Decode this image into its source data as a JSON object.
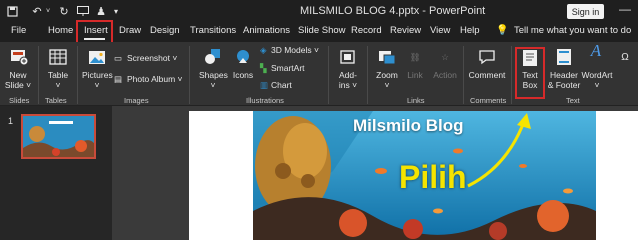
{
  "window": {
    "title": "MILSMILO BLOG 4.pptx  -  PowerPoint",
    "signin": "Sign in",
    "minimize": "—",
    "quick_access": [
      "save-icon",
      "undo-icon",
      "redo-icon",
      "present-icon",
      "accessibility-icon",
      "customize-icon"
    ]
  },
  "tabs": [
    "File",
    "Home",
    "Insert",
    "Draw",
    "Design",
    "Transitions",
    "Animations",
    "Slide Show",
    "Record",
    "Review",
    "View",
    "Help"
  ],
  "active_tab": "Insert",
  "tell_me": "Tell me what you want to do",
  "ribbon": {
    "new_slide": [
      "New",
      "Slide ˅"
    ],
    "table": [
      "Table",
      "˅"
    ],
    "pictures": [
      "Pictures",
      "˅"
    ],
    "screenshot": "Screenshot ˅",
    "photo_album": "Photo Album ˅",
    "shapes": [
      "Shapes",
      "˅"
    ],
    "icons": "Icons",
    "models_3d": "3D Models ˅",
    "smartart": "SmartArt",
    "chart": "Chart",
    "addins": [
      "Add-",
      "ins ˅"
    ],
    "zoom": [
      "Zoom",
      "˅"
    ],
    "link": "Link",
    "action": "Action",
    "comment": "Comment",
    "text_box": [
      "Text",
      "Box"
    ],
    "header_footer": [
      "Header",
      "& Footer"
    ],
    "wordart": [
      "WordArt",
      "˅"
    ]
  },
  "groups": [
    "Slides",
    "Tables",
    "Images",
    "Illustrations",
    "Links",
    "Comments",
    "Text"
  ],
  "colors": {
    "highlight": "#d62a2a",
    "title_text": "#ffffff",
    "callout_text": "#f5e400"
  },
  "slide": {
    "number": "1",
    "title": "Milsmilo Blog",
    "callout": "Pilih"
  }
}
